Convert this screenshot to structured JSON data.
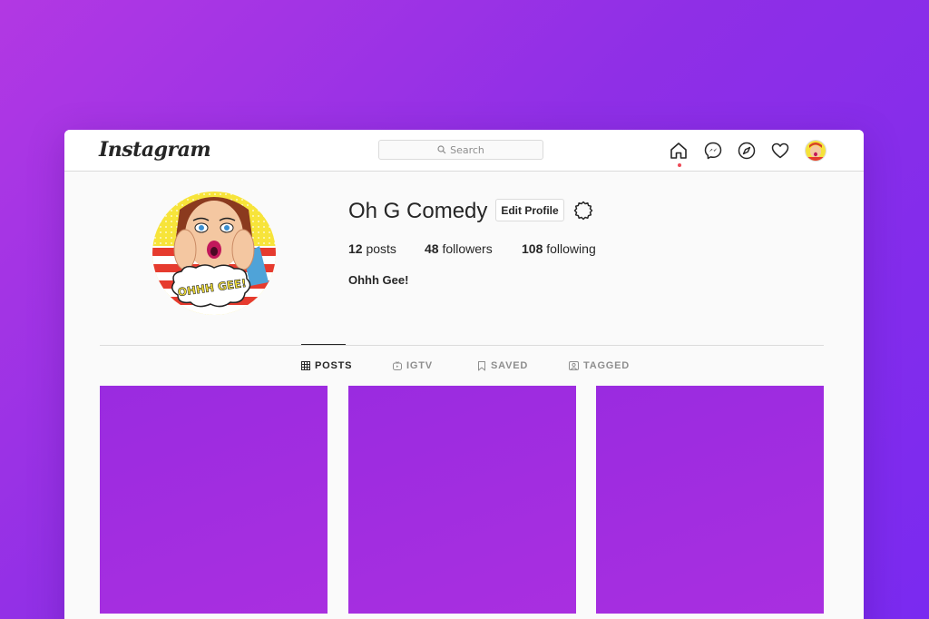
{
  "app": {
    "logo_text": "Instagram"
  },
  "search": {
    "placeholder": "Search"
  },
  "nav": {
    "icons": [
      "home-icon",
      "messenger-icon",
      "explore-icon",
      "heart-icon",
      "avatar"
    ]
  },
  "profile": {
    "username": "Oh G Comedy",
    "edit_label": "Edit Profile",
    "posts_count": "12",
    "posts_label": "posts",
    "followers_count": "48",
    "followers_label": "followers",
    "following_count": "108",
    "following_label": "following",
    "bio": "Ohhh Gee!",
    "avatar_caption": "OHHH GEE!"
  },
  "tabs": [
    {
      "label": "POSTS",
      "icon": "grid-icon",
      "active": true
    },
    {
      "label": "IGTV",
      "icon": "igtv-icon",
      "active": false
    },
    {
      "label": "SAVED",
      "icon": "bookmark-icon",
      "active": false
    },
    {
      "label": "TAGGED",
      "icon": "tag-person-icon",
      "active": false
    }
  ],
  "posts": [
    {
      "color": "#a02de0"
    },
    {
      "color": "#a02de0"
    },
    {
      "color": "#a02de0"
    }
  ],
  "colors": {
    "background_start": "#b238e3",
    "background_end": "#7a2af0",
    "post_fill": "#a02de0",
    "notification_dot": "#ed4956"
  }
}
